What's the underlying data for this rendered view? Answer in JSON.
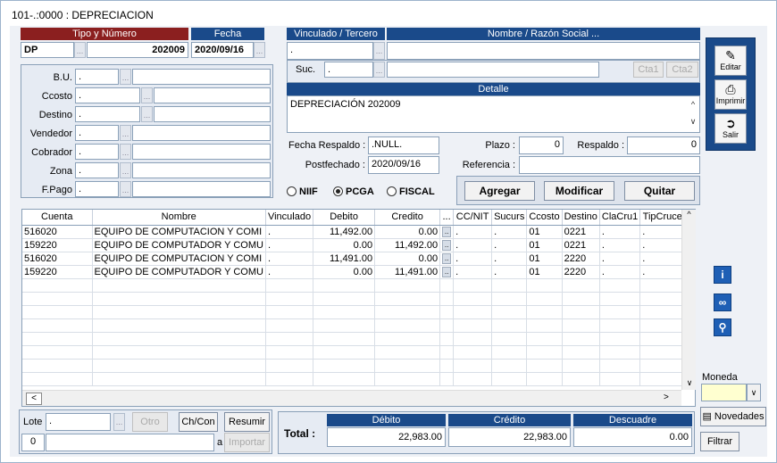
{
  "window": {
    "title": "101-.:0000 : DEPRECIACION"
  },
  "header": {
    "tipo_label": "Tipo y Número",
    "fecha_label": "Fecha",
    "tipo_value": "DP",
    "numero_value": "202009",
    "fecha_value": "2020/09/16",
    "vinculado_label": "Vinculado / Tercero",
    "nombre_label": "Nombre / Razón Social ...",
    "vinculado_value": ".",
    "suc_label": "Suc.",
    "suc_value": ".",
    "cta1_label": "Cta1",
    "cta2_label": "Cta2"
  },
  "left_fields": [
    {
      "label": "B.U.",
      "value": "."
    },
    {
      "label": "Ccosto",
      "value": "."
    },
    {
      "label": "Destino",
      "value": "."
    },
    {
      "label": "Vendedor",
      "value": "."
    },
    {
      "label": "Cobrador",
      "value": "."
    },
    {
      "label": "Zona",
      "value": "."
    },
    {
      "label": "F.Pago",
      "value": "."
    }
  ],
  "detalle": {
    "label": "Detalle",
    "value": "DEPRECIACIÓN 202009"
  },
  "info": {
    "fecha_respaldo_label": "Fecha Respaldo :",
    "fecha_respaldo_value": ".NULL.",
    "plazo_label": "Plazo :",
    "plazo_value": "0",
    "respaldo_label": "Respaldo :",
    "respaldo_value": "0",
    "postfechado_label": "Postfechado :",
    "postfechado_value": "2020/09/16",
    "referencia_label": "Referencia :",
    "referencia_value": ""
  },
  "radios": [
    {
      "label": "NIIF",
      "selected": false
    },
    {
      "label": "PCGA",
      "selected": true
    },
    {
      "label": "FISCAL",
      "selected": false
    }
  ],
  "actions": {
    "agregar": "Agregar",
    "modificar": "Modificar",
    "quitar": "Quitar"
  },
  "side": {
    "editar": "Editar",
    "imprimir": "Imprimir",
    "salir": "Salir"
  },
  "grid": {
    "columns": [
      "Cuenta",
      "Nombre",
      "Vinculado",
      "Debito",
      "Credito",
      "...",
      "CC/NIT",
      "Sucurs",
      "Ccosto",
      "Destino",
      "ClaCru1",
      "TipCruce"
    ],
    "rows": [
      [
        "516020",
        "EQUIPO DE COMPUTACION Y COMI",
        ".",
        "11,492.00",
        "0.00",
        ".",
        ".",
        "01",
        "0221",
        ".",
        "."
      ],
      [
        "159220",
        "EQUIPO DE COMPUTADOR Y COMU",
        ".",
        "0.00",
        "11,492.00",
        ".",
        ".",
        "01",
        "0221",
        ".",
        "."
      ],
      [
        "516020",
        "EQUIPO DE COMPUTACION Y COMI",
        ".",
        "11,491.00",
        "0.00",
        ".",
        ".",
        "01",
        "2220",
        ".",
        "."
      ],
      [
        "159220",
        "EQUIPO DE COMPUTADOR Y COMU",
        ".",
        "0.00",
        "11,491.00",
        ".",
        ".",
        "01",
        "2220",
        ".",
        "."
      ]
    ]
  },
  "bottom": {
    "lote_label": "Lote",
    "lote_value": ".",
    "otro_label": "Otro",
    "chcon_label": "Ch/Con",
    "resumir_label": "Resumir",
    "importar_label": "Importar",
    "count_value": "0",
    "a_label": "a",
    "total_label": "Total :",
    "debito_label": "Débito",
    "credito_label": "Crédito",
    "descuadre_label": "Descuadre",
    "debito_value": "22,983.00",
    "credito_value": "22,983.00",
    "descuadre_value": "0.00"
  },
  "right": {
    "moneda_label": "Moneda",
    "moneda_value": "",
    "novedades_label": "Novedades",
    "filtrar_label": "Filtrar"
  }
}
